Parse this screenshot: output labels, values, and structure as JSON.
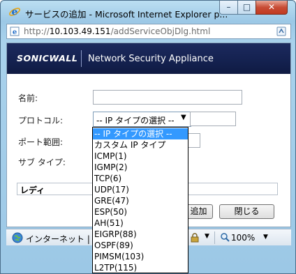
{
  "window": {
    "title": "サービスの追加 - Microsoft Internet Explorer p...",
    "minimize": "–",
    "maximize": "□",
    "close": "✕"
  },
  "address": {
    "prefix": "http://",
    "host": "10.103.49.151",
    "path": "/addServiceObjDlg.html"
  },
  "banner": {
    "logo": "SONICWALL",
    "title": "Network Security Appliance"
  },
  "form": {
    "name_label": "名前:",
    "protocol_label": "プロトコル:",
    "protocol_value": "-- IP タイプの選択 --",
    "port_label": "ポート範囲:",
    "subtype_label": "サブ タイプ:",
    "status": "レディ",
    "add_button": "追加",
    "close_button": "閉じる"
  },
  "dropdown": {
    "selected_index": 0,
    "options": [
      "-- IP タイプの選択 --",
      "カスタム IP タイプ",
      "ICMP(1)",
      "IGMP(2)",
      "TCP(6)",
      "UDP(17)",
      "GRE(47)",
      "ESP(50)",
      "AH(51)",
      "EIGRP(88)",
      "OSPF(89)",
      "PIMSM(103)",
      "L2TP(115)"
    ]
  },
  "statusbar": {
    "zone": "インターネット | 保護モード: 無効",
    "zoom": "100%"
  },
  "icons": {
    "app": "ie-logo-icon",
    "page": "page-icon",
    "addr_action": "compatibility-view-icon",
    "zone": "globe-icon",
    "zoom": "magnifier-icon"
  },
  "colors": {
    "banner": "#14214f",
    "selection": "#3399ff"
  }
}
